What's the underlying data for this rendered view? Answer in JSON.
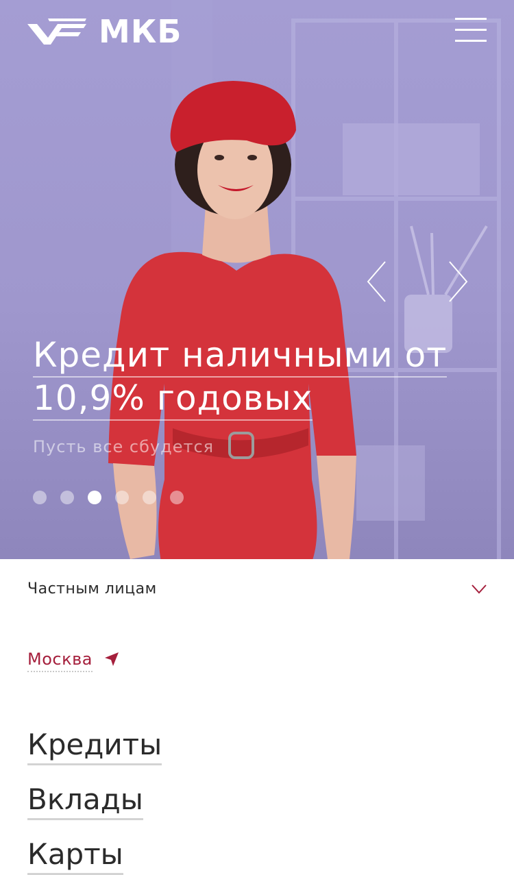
{
  "header": {
    "logo_text": "МКБ",
    "logo_icon": "mkb-logo-mark",
    "menu_icon": "hamburger-icon"
  },
  "hero": {
    "headline_line1": "Кредит наличными от",
    "headline_line2": "10,9% годовых",
    "subline": "Пусть все сбудется",
    "prev_icon": "chevron-left-icon",
    "next_icon": "chevron-right-icon",
    "slides_total": 6,
    "active_slide": 3,
    "background_color": "#a49dd3"
  },
  "segment": {
    "label": "Частным лицам",
    "icon": "chevron-down-icon"
  },
  "city": {
    "label": "Москва",
    "icon": "location-arrow-icon"
  },
  "menu": {
    "items": [
      "Кредиты",
      "Вклады",
      "Карты"
    ]
  },
  "colors": {
    "accent": "#a51f3c",
    "text": "#2b2b2b",
    "underline": "#d3d3d3"
  }
}
